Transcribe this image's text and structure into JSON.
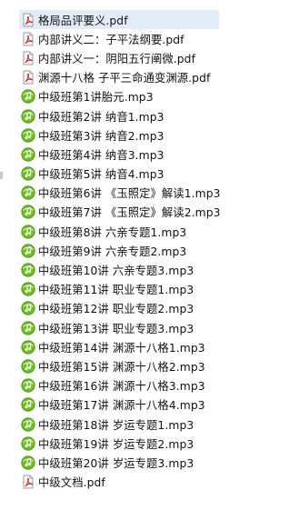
{
  "file_list": {
    "items": [
      {
        "name": "格局品评要义.pdf",
        "icon": "pdf-icon",
        "selected": true
      },
      {
        "name": "内部讲义二：子平法纲要.pdf",
        "icon": "pdf-icon",
        "selected": false
      },
      {
        "name": "内部讲义一：阴阳五行阐微.pdf",
        "icon": "pdf-icon",
        "selected": false
      },
      {
        "name": "渊源十八格 子平三命通变渊源.pdf",
        "icon": "pdf-icon",
        "selected": false
      },
      {
        "name": "中级班第1讲胎元.mp3",
        "icon": "mp3-icon",
        "selected": false
      },
      {
        "name": "中级班第2讲   纳音1.mp3",
        "icon": "mp3-icon",
        "selected": false
      },
      {
        "name": "中级班第3讲   纳音2.mp3",
        "icon": "mp3-icon",
        "selected": false
      },
      {
        "name": "中级班第4讲   纳音3.mp3",
        "icon": "mp3-icon",
        "selected": false
      },
      {
        "name": "中级班第5讲   纳音4.mp3",
        "icon": "mp3-icon",
        "selected": false
      },
      {
        "name": "中级班第6讲   《玉照定》解读1.mp3",
        "icon": "mp3-icon",
        "selected": false
      },
      {
        "name": "中级班第7讲   《玉照定》解读2.mp3",
        "icon": "mp3-icon",
        "selected": false
      },
      {
        "name": "中级班第8讲   六亲专题1.mp3",
        "icon": "mp3-icon",
        "selected": false
      },
      {
        "name": "中级班第9讲   六亲专题2.mp3",
        "icon": "mp3-icon",
        "selected": false
      },
      {
        "name": "中级班第10讲   六亲专题3.mp3",
        "icon": "mp3-icon",
        "selected": false
      },
      {
        "name": "中级班第11讲   职业专题1.mp3",
        "icon": "mp3-icon",
        "selected": false
      },
      {
        "name": "中级班第12讲   职业专题2.mp3",
        "icon": "mp3-icon",
        "selected": false
      },
      {
        "name": "中级班第13讲   职业专题3.mp3",
        "icon": "mp3-icon",
        "selected": false
      },
      {
        "name": "中级班第14讲 渊源十八格1.mp3",
        "icon": "mp3-icon",
        "selected": false
      },
      {
        "name": "中级班第15讲 渊源十八格2.mp3",
        "icon": "mp3-icon",
        "selected": false
      },
      {
        "name": "中级班第16讲 渊源十八格3.mp3",
        "icon": "mp3-icon",
        "selected": false
      },
      {
        "name": "中级班第17讲 渊源十八格4.mp3",
        "icon": "mp3-icon",
        "selected": false
      },
      {
        "name": "中级班第18讲 岁运专题1.mp3",
        "icon": "mp3-icon",
        "selected": false
      },
      {
        "name": "中级班第19讲 岁运专题2.mp3",
        "icon": "mp3-icon",
        "selected": false
      },
      {
        "name": "中级班第20讲 岁运专题3.mp3",
        "icon": "mp3-icon",
        "selected": false
      },
      {
        "name": "中级文档.pdf",
        "icon": "pdf-icon",
        "selected": false
      }
    ]
  },
  "colors": {
    "selection": "#e3ecf8",
    "pdf_red": "#c62828",
    "mp3_green": "#6fbf1f",
    "mp3_dark_green": "#3f8f0f",
    "text": "#111111"
  }
}
